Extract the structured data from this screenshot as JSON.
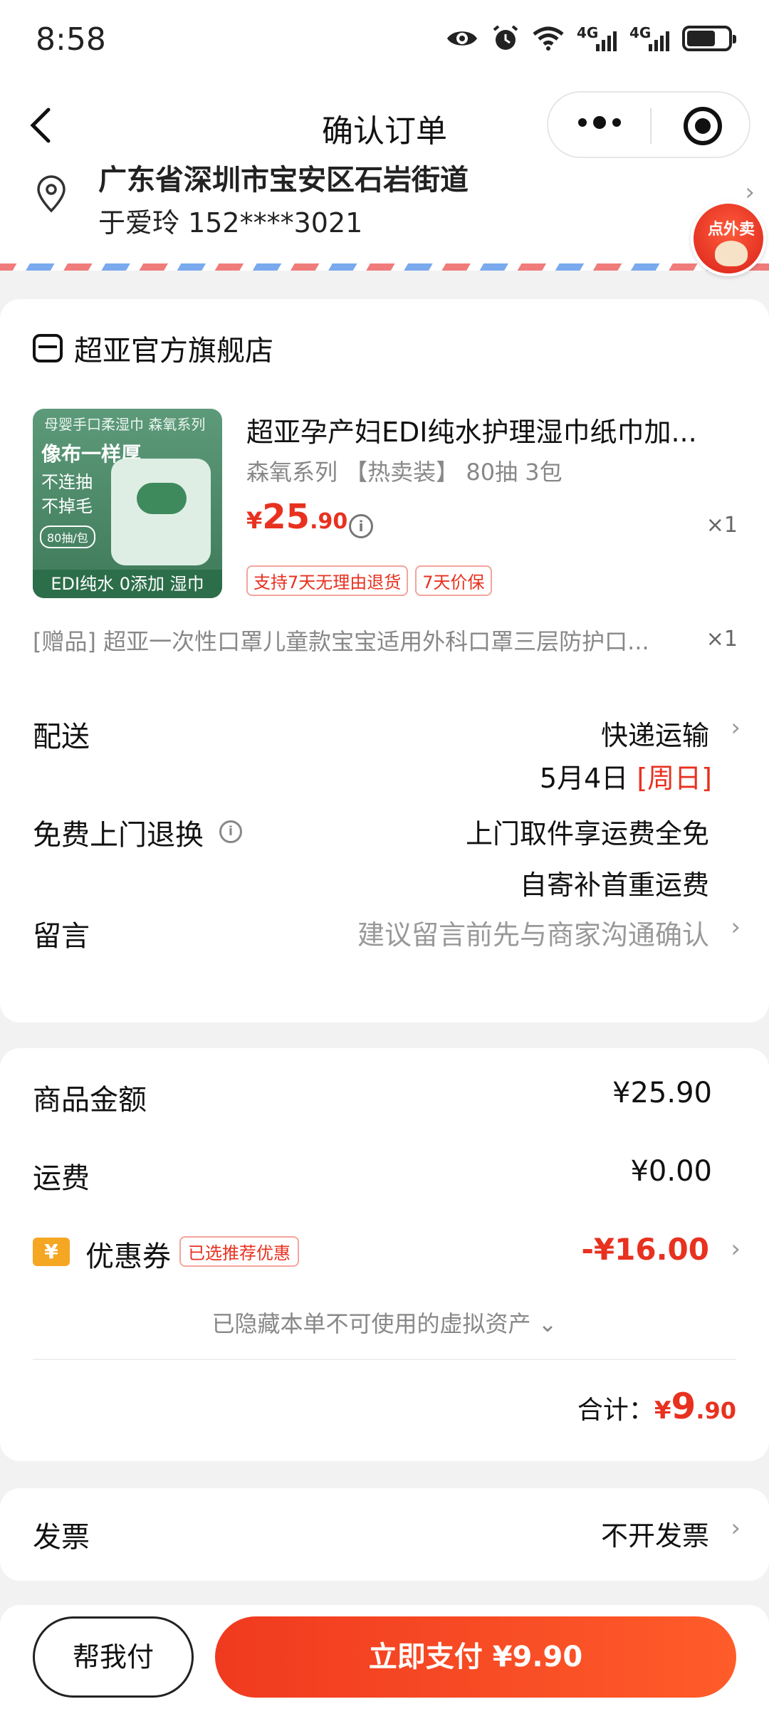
{
  "status_bar": {
    "time": "8:58",
    "network_labels": [
      "4G",
      "4G"
    ],
    "battery_level": 0.7
  },
  "navbar": {
    "title": "确认订单"
  },
  "address": {
    "line_partial": "广东省深圳市宝安区石岩街道",
    "recipient": "于爱玲 152****3021"
  },
  "float_badge": {
    "label": "点外卖"
  },
  "shop": {
    "name": "超亚官方旗舰店"
  },
  "product": {
    "image_texts": {
      "top": "母婴手口柔湿巾  森氧系列",
      "headline": "像布一样厚",
      "line1": "不连抽",
      "line2": "不掉毛",
      "pill": "80抽/包",
      "bottom": "EDI纯水 0添加 湿巾"
    },
    "title": "超亚孕产妇EDI纯水护理湿巾纸巾加...",
    "spec": "森氧系列 【热卖装】 80抽 3包",
    "price_symbol": "¥",
    "price_int": "25",
    "price_dec": ".90",
    "qty": "×1",
    "tags": [
      "支持7天无理由退货",
      "7天价保"
    ]
  },
  "gift": {
    "text": "[赠品] 超亚一次性口罩儿童款宝宝适用外科口罩三层防护口...",
    "qty": "×1"
  },
  "delivery": {
    "label": "配送",
    "method": "快递运输",
    "date": "5月4日",
    "weekday": "[周日]"
  },
  "return_service": {
    "label": "免费上门退换",
    "line1": "上门取件享运费全免",
    "line2": "自寄补首重运费"
  },
  "message": {
    "label": "留言",
    "placeholder": "建议留言前先与商家沟通确认"
  },
  "summary": {
    "goods_label": "商品金额",
    "goods_value": "¥25.90",
    "shipping_label": "运费",
    "shipping_value": "¥0.00",
    "coupon_label": "优惠券",
    "coupon_tag": "已选推荐优惠",
    "coupon_value": "-¥16.00",
    "hidden_assets": "已隐藏本单不可使用的虚拟资产 ⌄",
    "total_label": "合计：",
    "total_symbol": "¥",
    "total_int": "9",
    "total_dec": ".90"
  },
  "invoice": {
    "label": "发票",
    "value": "不开发票"
  },
  "bottom": {
    "help_pay": "帮我付",
    "pay_now": "立即支付 ¥9.90"
  },
  "colors": {
    "accent": "#e8311f",
    "pay_gradient_start": "#f03a1f",
    "pay_gradient_end": "#ff5c2a",
    "coupon_icon": "#f5a623"
  }
}
